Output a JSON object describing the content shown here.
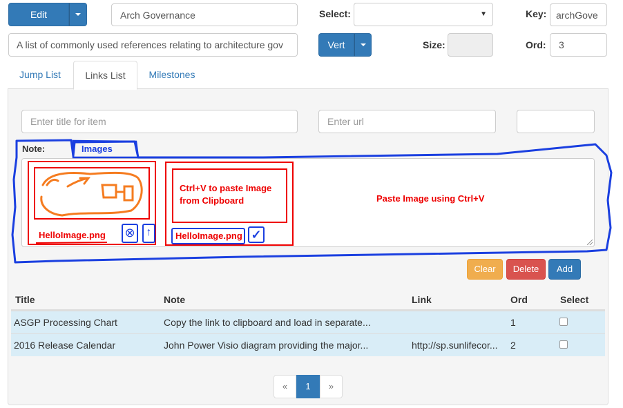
{
  "toolbar": {
    "edit_label": "Edit",
    "title_value": "Arch Governance",
    "select_label": "Select:",
    "select_value": "",
    "key_label": "Key:",
    "key_value": "archGove",
    "description_value": "A list of commonly used references relating to architecture gov",
    "vert_label": "Vert",
    "size_label": "Size:",
    "size_value": "",
    "ord_label": "Ord:",
    "ord_value": "3"
  },
  "tabs": [
    {
      "label": "Jump List",
      "active": false
    },
    {
      "label": "Links List",
      "active": true
    },
    {
      "label": "Milestones",
      "active": false
    }
  ],
  "form": {
    "title_placeholder": "Enter title for item",
    "url_placeholder": "Enter url",
    "extra_value": "",
    "note_label": "Note:",
    "images_label": "Images"
  },
  "annotations": {
    "image1_filename": "HelloImage.png",
    "paste_hint": "Ctrl+V to paste Image from Clipboard",
    "image2_filename": "HelloImage.png",
    "paste_instruction": "Paste Image using Ctrl+V"
  },
  "actions": {
    "clear_label": "Clear",
    "delete_label": "Delete",
    "add_label": "Add"
  },
  "table": {
    "headers": [
      "Title",
      "Note",
      "Link",
      "Ord",
      "Select"
    ],
    "rows": [
      {
        "title": "ASGP Processing Chart",
        "note": "Copy the link to clipboard and load in separate...",
        "link": "",
        "ord": "1",
        "selected": false
      },
      {
        "title": "2016 Release Calendar",
        "note": "John Power Visio diagram providing the major...",
        "link": "http://sp.sunlifecor...",
        "ord": "2",
        "selected": false
      }
    ]
  },
  "pagination": {
    "prev": "«",
    "current": "1",
    "next": "»"
  },
  "colors": {
    "primary": "#337ab7",
    "warning": "#f0ad4e",
    "danger": "#d9534f",
    "annotation_red": "#ee0000",
    "annotation_blue": "#1a3fe0",
    "row_highlight": "#d9edf7"
  }
}
